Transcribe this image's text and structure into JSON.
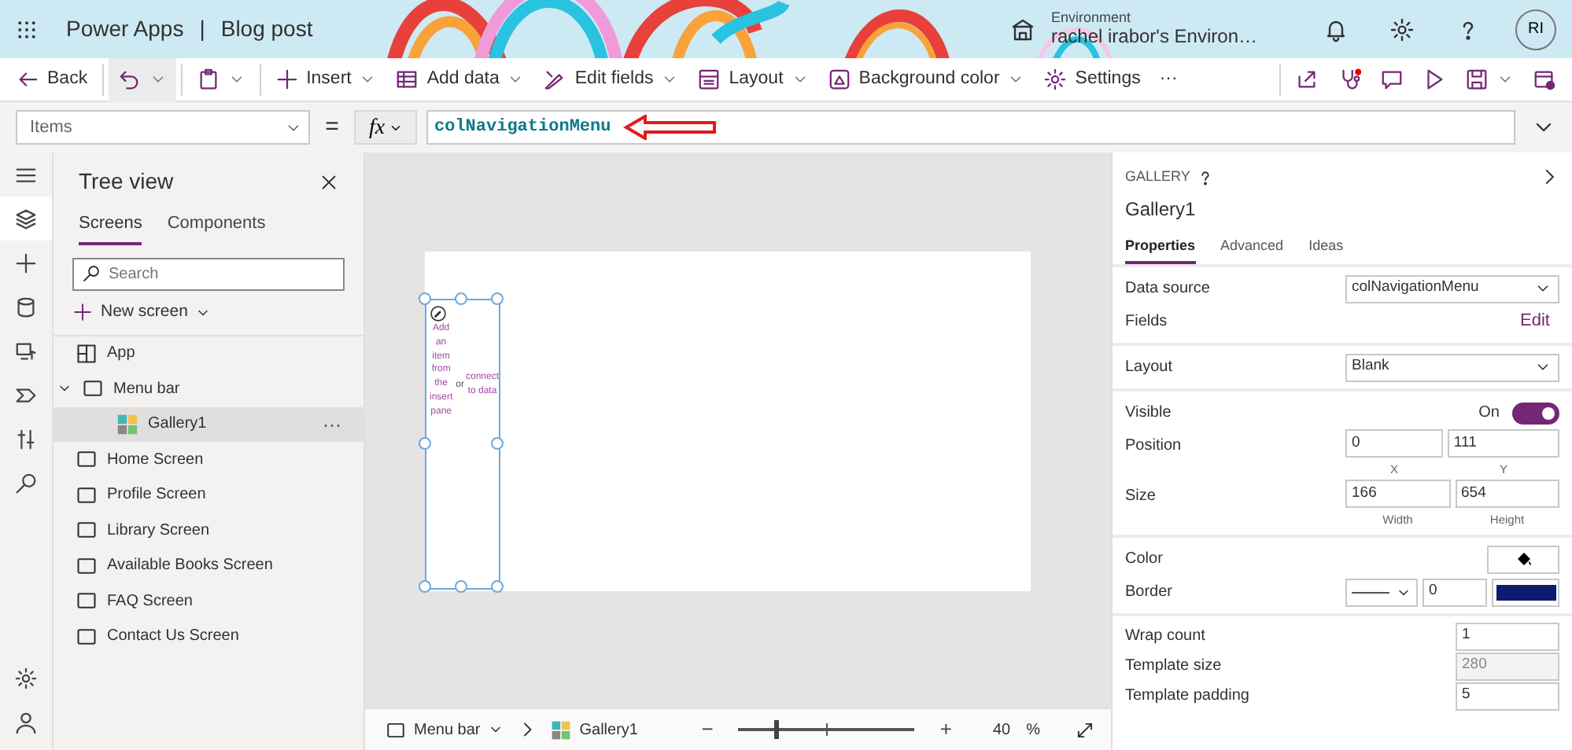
{
  "header": {
    "app_name": "Power Apps",
    "separator": "|",
    "document_name": "Blog post",
    "environment_label": "Environment",
    "environment_name": "rachel irabor's Environ…",
    "avatar": "RI"
  },
  "toolbar": {
    "left_groups": [
      [
        {
          "kind": "back",
          "label": "Back"
        }
      ],
      [
        {
          "kind": "undo",
          "dropdown": true
        }
      ],
      [
        {
          "kind": "paste",
          "dropdown": true
        }
      ],
      [
        {
          "kind": "plus",
          "label": "Insert",
          "dropdown": true
        },
        {
          "kind": "table",
          "label": "Add data",
          "dropdown": true
        },
        {
          "kind": "pen",
          "label": "Edit fields",
          "dropdown": true
        },
        {
          "kind": "layout",
          "label": "Layout",
          "dropdown": true
        },
        {
          "kind": "bg",
          "label": "Background color",
          "dropdown": true
        },
        {
          "kind": "gear",
          "label": "Settings"
        },
        {
          "label": "···"
        }
      ]
    ],
    "right_groups": [
      [
        {
          "kind": "share"
        },
        {
          "kind": "stethoscope",
          "alert": true
        },
        {
          "kind": "comment"
        },
        {
          "kind": "play"
        },
        {
          "kind": "save",
          "dropdown": true
        },
        {
          "kind": "publish"
        }
      ]
    ]
  },
  "formula_bar": {
    "property": "Items",
    "equals": "=",
    "fx": "fx",
    "formula": "colNavigationMenu"
  },
  "rail": {
    "top": [
      {
        "kind": "menu",
        "selected": false
      },
      {
        "kind": "layers",
        "selected": true
      },
      {
        "kind": "plus",
        "selected": false
      },
      {
        "kind": "cylinder",
        "selected": false
      },
      {
        "kind": "media",
        "selected": false
      },
      {
        "kind": "flow",
        "selected": false
      },
      {
        "kind": "tools",
        "selected": false
      },
      {
        "kind": "search",
        "selected": false
      }
    ],
    "bottom": [
      {
        "kind": "gear",
        "selected": false
      },
      {
        "kind": "person",
        "selected": false
      }
    ]
  },
  "tree": {
    "title": "Tree view",
    "tabs": [
      {
        "label": "Screens",
        "selected": true
      },
      {
        "label": "Components",
        "selected": false
      }
    ],
    "search_placeholder": "Search",
    "new_screen": "New screen",
    "items": [
      {
        "kind": "app",
        "label": "App",
        "selected": false
      },
      {
        "kind": "screen",
        "label": "Menu bar",
        "selected": false,
        "expanded": true,
        "children": [
          {
            "kind": "gallery",
            "label": "Gallery1",
            "selected": true,
            "more": "···"
          }
        ]
      },
      {
        "kind": "screen",
        "label": "Home Screen",
        "selected": false
      },
      {
        "kind": "screen",
        "label": "Profile Screen",
        "selected": false
      },
      {
        "kind": "screen",
        "label": "Library Screen",
        "selected": false
      },
      {
        "kind": "screen",
        "label": "Available Books Screen",
        "selected": false
      },
      {
        "kind": "screen",
        "label": "FAQ Screen",
        "selected": false
      },
      {
        "kind": "screen",
        "label": "Contact Us Screen",
        "selected": false
      }
    ]
  },
  "canvas": {
    "hint_add": "Add an item from the insert pane",
    "hint_or": "or",
    "hint_connect": "connect to data"
  },
  "status_bar": {
    "breadcrumbs": [
      {
        "kind": "screen",
        "label": "Menu bar",
        "dropdown": true
      },
      {
        "kind": "gallery",
        "label": "Gallery1"
      }
    ],
    "zoom_out": "−",
    "zoom_in": "+",
    "zoom": {
      "level": 0.2
    },
    "zoom_value": "40",
    "zoom_unit": "%"
  },
  "properties": {
    "type": "GALLERY",
    "name": "Gallery1",
    "tabs": [
      {
        "label": "Properties",
        "selected": true
      },
      {
        "label": "Advanced",
        "selected": false
      },
      {
        "label": "Ideas",
        "selected": false
      }
    ],
    "sections": [
      [
        {
          "kind": "dropdown",
          "label": "Data source",
          "value": "colNavigationMenu"
        },
        {
          "kind": "link",
          "label": "Fields",
          "value": "Edit"
        }
      ],
      [
        {
          "kind": "dropdown",
          "label": "Layout",
          "value": "Blank"
        }
      ],
      [
        {
          "kind": "toggle",
          "label": "Visible",
          "state_label": "On",
          "on": true
        },
        {
          "kind": "pair",
          "label": "Position",
          "fields": [
            {
              "value": "0",
              "caption": "X"
            },
            {
              "value": "111",
              "caption": "Y"
            }
          ]
        },
        {
          "kind": "pair",
          "label": "Size",
          "fields": [
            {
              "value": "166",
              "caption": "Width"
            },
            {
              "value": "654",
              "caption": "Height"
            }
          ]
        }
      ],
      [
        {
          "kind": "color",
          "label": "Color"
        },
        {
          "kind": "border",
          "label": "Border",
          "value": "0",
          "color": "#0b1c6e"
        }
      ],
      [
        {
          "kind": "input",
          "label": "Wrap count",
          "value": "1",
          "disabled": false
        },
        {
          "kind": "input",
          "label": "Template size",
          "value": "280",
          "disabled": true
        },
        {
          "kind": "input",
          "label": "Template padding",
          "value": "5",
          "disabled": false
        }
      ]
    ]
  }
}
